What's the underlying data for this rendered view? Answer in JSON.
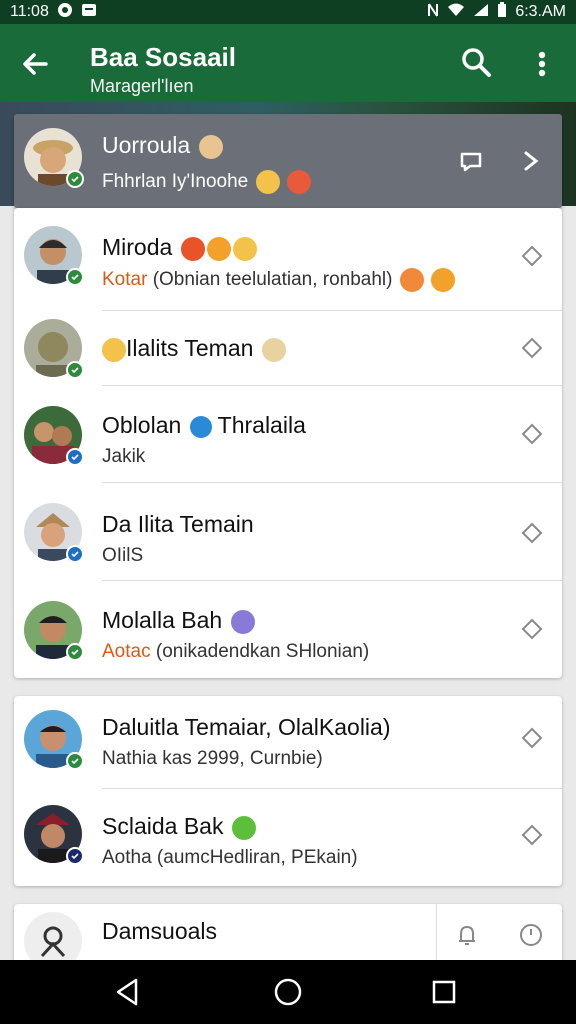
{
  "status": {
    "time": "11:08",
    "right_time": "6:3.AM"
  },
  "appbar": {
    "title": "Baa Sosaail",
    "subtitle": "Maragerl'lıen"
  },
  "highlight": {
    "name": "Uorroula",
    "sub": "Fhhrlan  Iy'Inoohe"
  },
  "group1": [
    {
      "name": "Miroda",
      "sub_highlight": "Kotar",
      "sub_rest": " (Obnian teelulatian, ronbahl)"
    },
    {
      "name": "Ilalits Teman",
      "sub_highlight": "",
      "sub_rest": ""
    },
    {
      "name_a": "Oblolan",
      "name_b": "Thralaila",
      "sub_highlight": "",
      "sub_rest": "Jakik"
    },
    {
      "name": "Da Ilita Temain",
      "sub_highlight": "",
      "sub_rest": "OIilS"
    },
    {
      "name": "Molalla Bah",
      "sub_highlight": "Aotac",
      "sub_rest": " (onikadendkan SHlonian)"
    }
  ],
  "group2": [
    {
      "name": "Daluitla Temaiar, OlalKaolia)",
      "sub": "Nathia kas 2999, Curnbie)"
    },
    {
      "name": "Sclaida Bak",
      "sub": "Aotha (aumcHedliran, PEkain)"
    }
  ],
  "partial": {
    "name": "Damsuoals"
  },
  "icons": {
    "back": "arrow-left-icon",
    "search": "search-icon",
    "more": "more-vert-icon",
    "row_action": "diamond-outline-icon",
    "bell": "bell-icon",
    "clock": "clock-icon"
  },
  "colors": {
    "appbar": "#1a6b3a",
    "statusbar": "#0f3f22",
    "accent_text": "#d85a1a",
    "badge_green": "#2e8b3e",
    "badge_blue": "#1e6fc4"
  }
}
